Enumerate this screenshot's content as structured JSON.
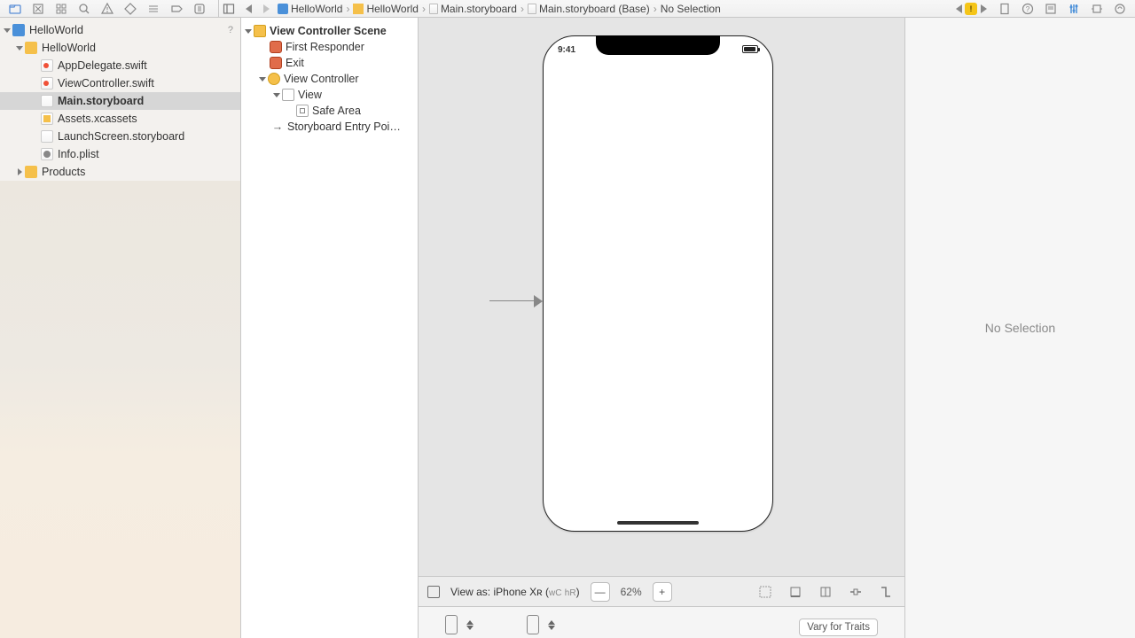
{
  "breadcrumb": {
    "items": [
      "HelloWorld",
      "HelloWorld",
      "Main.storyboard",
      "Main.storyboard (Base)",
      "No Selection"
    ]
  },
  "navigator": {
    "root": "HelloWorld",
    "help": "?",
    "group": "HelloWorld",
    "files": {
      "appdelegate": "AppDelegate.swift",
      "viewcontroller": "ViewController.swift",
      "main_sb": "Main.storyboard",
      "assets": "Assets.xcassets",
      "launch_sb": "LaunchScreen.storyboard",
      "plist": "Info.plist"
    },
    "products": "Products"
  },
  "outline": {
    "scene": "View Controller Scene",
    "first_responder": "First Responder",
    "exit": "Exit",
    "view_controller": "View Controller",
    "view": "View",
    "safe_area": "Safe Area",
    "entry": "Storyboard Entry Poi…"
  },
  "canvas": {
    "status_time": "9:41",
    "view_as_label": "View as: iPhone Xʀ (",
    "view_as_wc": "wC",
    "view_as_hr": "hR",
    "view_as_close": ")",
    "zoom": "62%",
    "minus": "—",
    "plus": "+",
    "vary": "Vary for Traits"
  },
  "inspector": {
    "empty": "No Selection"
  }
}
